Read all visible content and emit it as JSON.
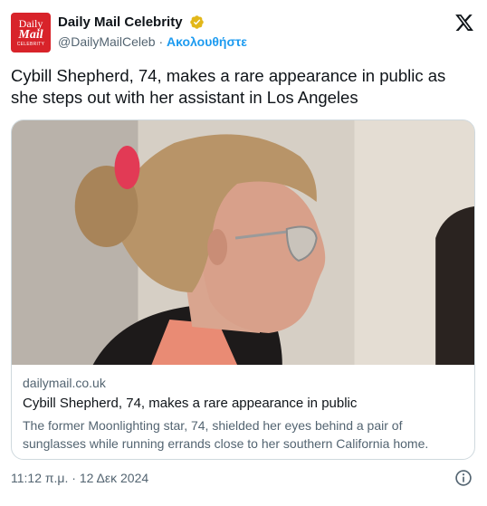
{
  "account": {
    "logo_line1": "Daily",
    "logo_line2": "Mail",
    "logo_line3": "CELEBRITY",
    "display_name": "Daily Mail Celebrity",
    "handle": "@DailyMailCeleb",
    "separator": " · ",
    "follow_label": "Ακολουθήστε",
    "verified_icon": "verified-badge-icon",
    "verified_color": "#e2b719",
    "brand_color": "#d8232a"
  },
  "tweet": {
    "text": "Cybill Shepherd, 74, makes a rare appearance in public as she steps out with her assistant in Los Angeles"
  },
  "card": {
    "domain": "dailymail.co.uk",
    "title": "Cybill Shepherd, 74, makes a rare appearance in public",
    "description": "The former Moonlighting star, 74, shielded her eyes behind a pair of sunglasses while running errands close to her southern California home."
  },
  "meta": {
    "timestamp": "11:12 π.μ. · 12 Δεκ 2024",
    "link_color": "#1d9bf0"
  }
}
